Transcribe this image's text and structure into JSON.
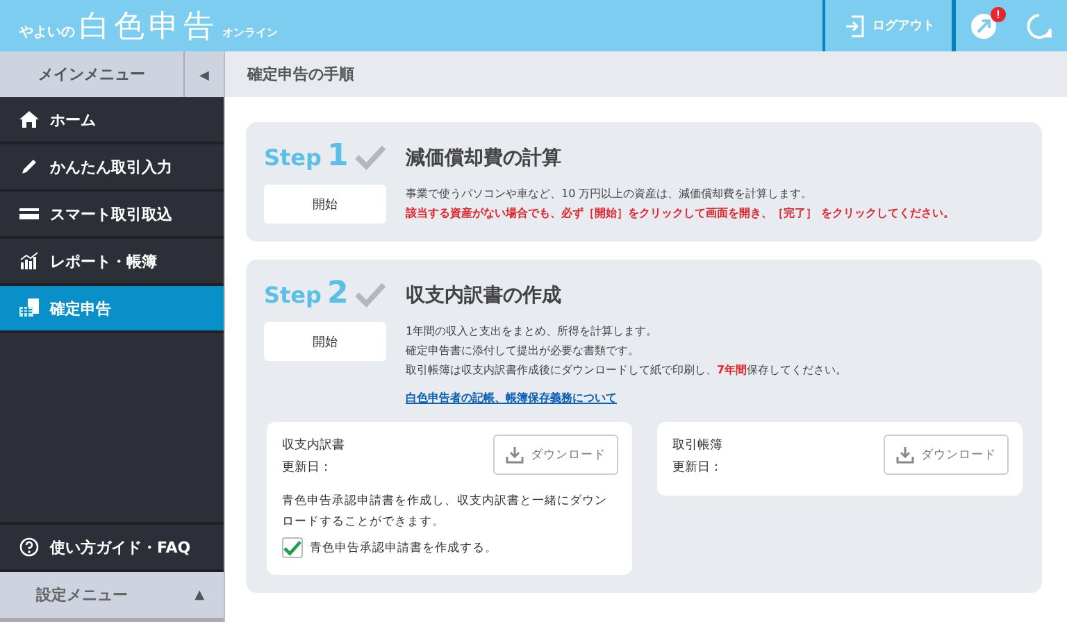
{
  "header": {
    "logo_prefix": "やよいの",
    "logo_main": "白色申告",
    "logo_suffix": "オンライン",
    "logout": "ログアウト",
    "notification_badge": "!"
  },
  "sidebar": {
    "title": "メインメニュー",
    "collapse": "◀",
    "items": [
      {
        "label": "ホーム",
        "selected": false
      },
      {
        "label": "かんたん取引入力",
        "selected": false
      },
      {
        "label": "スマート取引取込",
        "selected": false
      },
      {
        "label": "レポート・帳簿",
        "selected": false
      },
      {
        "label": "確定申告",
        "selected": true
      }
    ],
    "guide": "使い方ガイド・FAQ",
    "settings": "設定メニュー",
    "settings_toggle": "▲"
  },
  "page_title": "確定申告の手順",
  "steps": [
    {
      "step_word": "Step",
      "number": "1",
      "done": true,
      "title": "減価償却費の計算",
      "button": "開始",
      "lines": [
        {
          "kind": "normal",
          "parts": [
            {
              "text": "事業で使うパソコンや車など、10 万円以上の資産は、減価償却費を計算します。",
              "emphasis": false
            }
          ]
        },
        {
          "kind": "normal",
          "parts": [
            {
              "text": "該当する資産がない場合でも、必ず［開始］をクリックして画面を開き、［完了］ をクリックしてください。",
              "emphasis": true
            }
          ]
        }
      ]
    },
    {
      "step_word": "Step",
      "number": "2",
      "done": true,
      "title": "収支内訳書の作成",
      "button": "開始",
      "lines": [
        {
          "kind": "normal",
          "parts": [
            {
              "text": "1年間の収入と支出をまとめ、所得を計算します。",
              "emphasis": false
            }
          ]
        },
        {
          "kind": "normal",
          "parts": [
            {
              "text": "確定申告書に添付して提出が必要な書類です。",
              "emphasis": false
            }
          ]
        },
        {
          "kind": "normal",
          "parts": [
            {
              "text": "取引帳簿は収支内訳書作成後にダウンロードして紙で印刷し、",
              "emphasis": false
            },
            {
              "text": "7年間",
              "emphasis": true
            },
            {
              "text": "保存してください。",
              "emphasis": false
            }
          ]
        },
        {
          "kind": "link",
          "parts": [
            {
              "text": "白色申告者の記帳、帳簿保存義務について",
              "emphasis": false
            }
          ]
        }
      ],
      "documents": [
        {
          "name": "収支内訳書",
          "updated": "更新日：",
          "download": "ダウンロード",
          "note": "青色申告承認申請書を作成し、収支内訳書と一緒にダウンロードすることができます。",
          "checkbox": {
            "label": "青色申告承認申請書を作成する。",
            "checked": true
          }
        },
        {
          "name": "取引帳簿",
          "updated": "更新日：",
          "download": "ダウンロード"
        }
      ]
    }
  ]
}
